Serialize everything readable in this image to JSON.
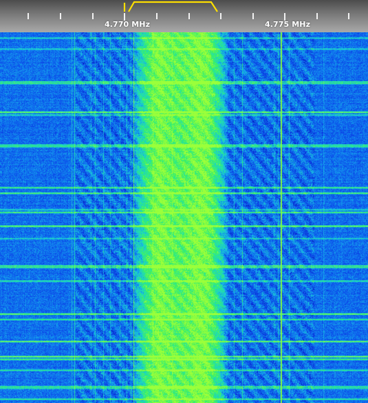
{
  "scale": {
    "labels": [
      {
        "text": "4.770 MHz"
      },
      {
        "text": "4.775 MHz"
      }
    ]
  },
  "colors": {
    "scale_text": "#ffffff",
    "tick": "#f2f2f2",
    "passband": "#ffe000",
    "waterfall_background": "#0a2fd6",
    "waterfall_signal": "#20e860",
    "carrier_line": "#7cff3a"
  },
  "waterfall": {
    "palette": [
      "#0418a8",
      "#0a34e0",
      "#0f6cf0",
      "#17b8e8",
      "#22e4a8",
      "#3cf060",
      "#9cff3a"
    ]
  }
}
